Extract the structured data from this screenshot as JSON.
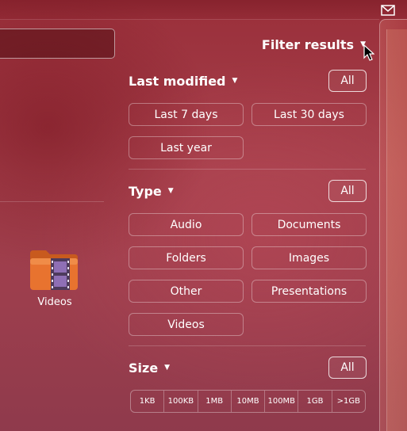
{
  "filter": {
    "header_label": "Filter results",
    "sections": {
      "last_modified": {
        "title": "Last modified",
        "all_label": "All",
        "options": [
          "Last 7 days",
          "Last 30 days",
          "Last year"
        ]
      },
      "type": {
        "title": "Type",
        "all_label": "All",
        "options": [
          "Audio",
          "Documents",
          "Folders",
          "Images",
          "Other",
          "Presentations",
          "Videos"
        ]
      },
      "size": {
        "title": "Size",
        "all_label": "All",
        "options": [
          "1KB",
          "100KB",
          "1MB",
          "10MB",
          "100MB",
          "1GB",
          ">1GB"
        ]
      }
    }
  },
  "results": {
    "items": [
      {
        "label": "Videos",
        "icon": "videos-folder-icon"
      }
    ]
  },
  "icons": {
    "mail": "envelope-icon",
    "cursor": "mouse-pointer-icon",
    "dropdown": "triangle-down-icon"
  },
  "colors": {
    "background": "#a5404c",
    "text": "#ffffff",
    "folder": "#e8732f",
    "film": "#7a5fa0"
  }
}
